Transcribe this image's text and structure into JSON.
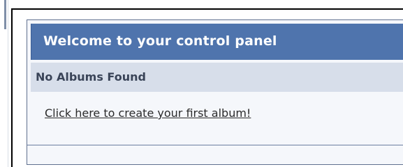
{
  "control_panel": {
    "title": "Welcome to your control panel",
    "status": "No Albums Found",
    "create_link": "Click here to create your first album!"
  },
  "colors": {
    "header": "#4f74ad",
    "status_row": "#d7deea",
    "panel_background": "#f5f7fb",
    "outer_border": "#000000"
  },
  "icons": []
}
